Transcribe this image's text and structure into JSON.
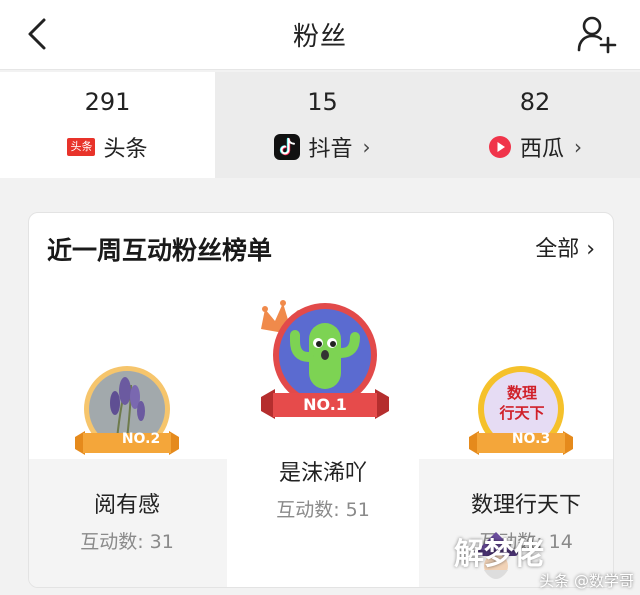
{
  "header": {
    "title": "粉丝"
  },
  "stats": [
    {
      "count": "291",
      "label": "头条",
      "icon_text": "头条",
      "icon": "toutiao-icon",
      "chevron": ""
    },
    {
      "count": "15",
      "label": "抖音",
      "icon": "douyin-icon",
      "chevron": "›"
    },
    {
      "count": "82",
      "label": "西瓜",
      "icon": "xigua-icon",
      "chevron": "›"
    }
  ],
  "ranking": {
    "title": "近一周互动粉丝榜单",
    "all_label": "全部 ›",
    "fans": [
      {
        "rank_label": "NO.1",
        "name": "是沫浠吖",
        "score": "互动数: 51"
      },
      {
        "rank_label": "NO.2",
        "name": "阅有感",
        "score": "互动数: 31"
      },
      {
        "rank_label": "NO.3",
        "name": "数理行天下",
        "score": "互动数: 14",
        "avatar_text": [
          "数理",
          "行天下"
        ]
      }
    ]
  },
  "watermark": {
    "logo": "解梦佬",
    "caption": "头条 @数学哥"
  },
  "colors": {
    "toutiao_red": "#e8332a",
    "ribbon_red": "#e64b4b",
    "gold": "#f5a623",
    "orange": "#f39b2a",
    "active_bg": "#ffffff",
    "inactive_bg": "#ececec"
  }
}
